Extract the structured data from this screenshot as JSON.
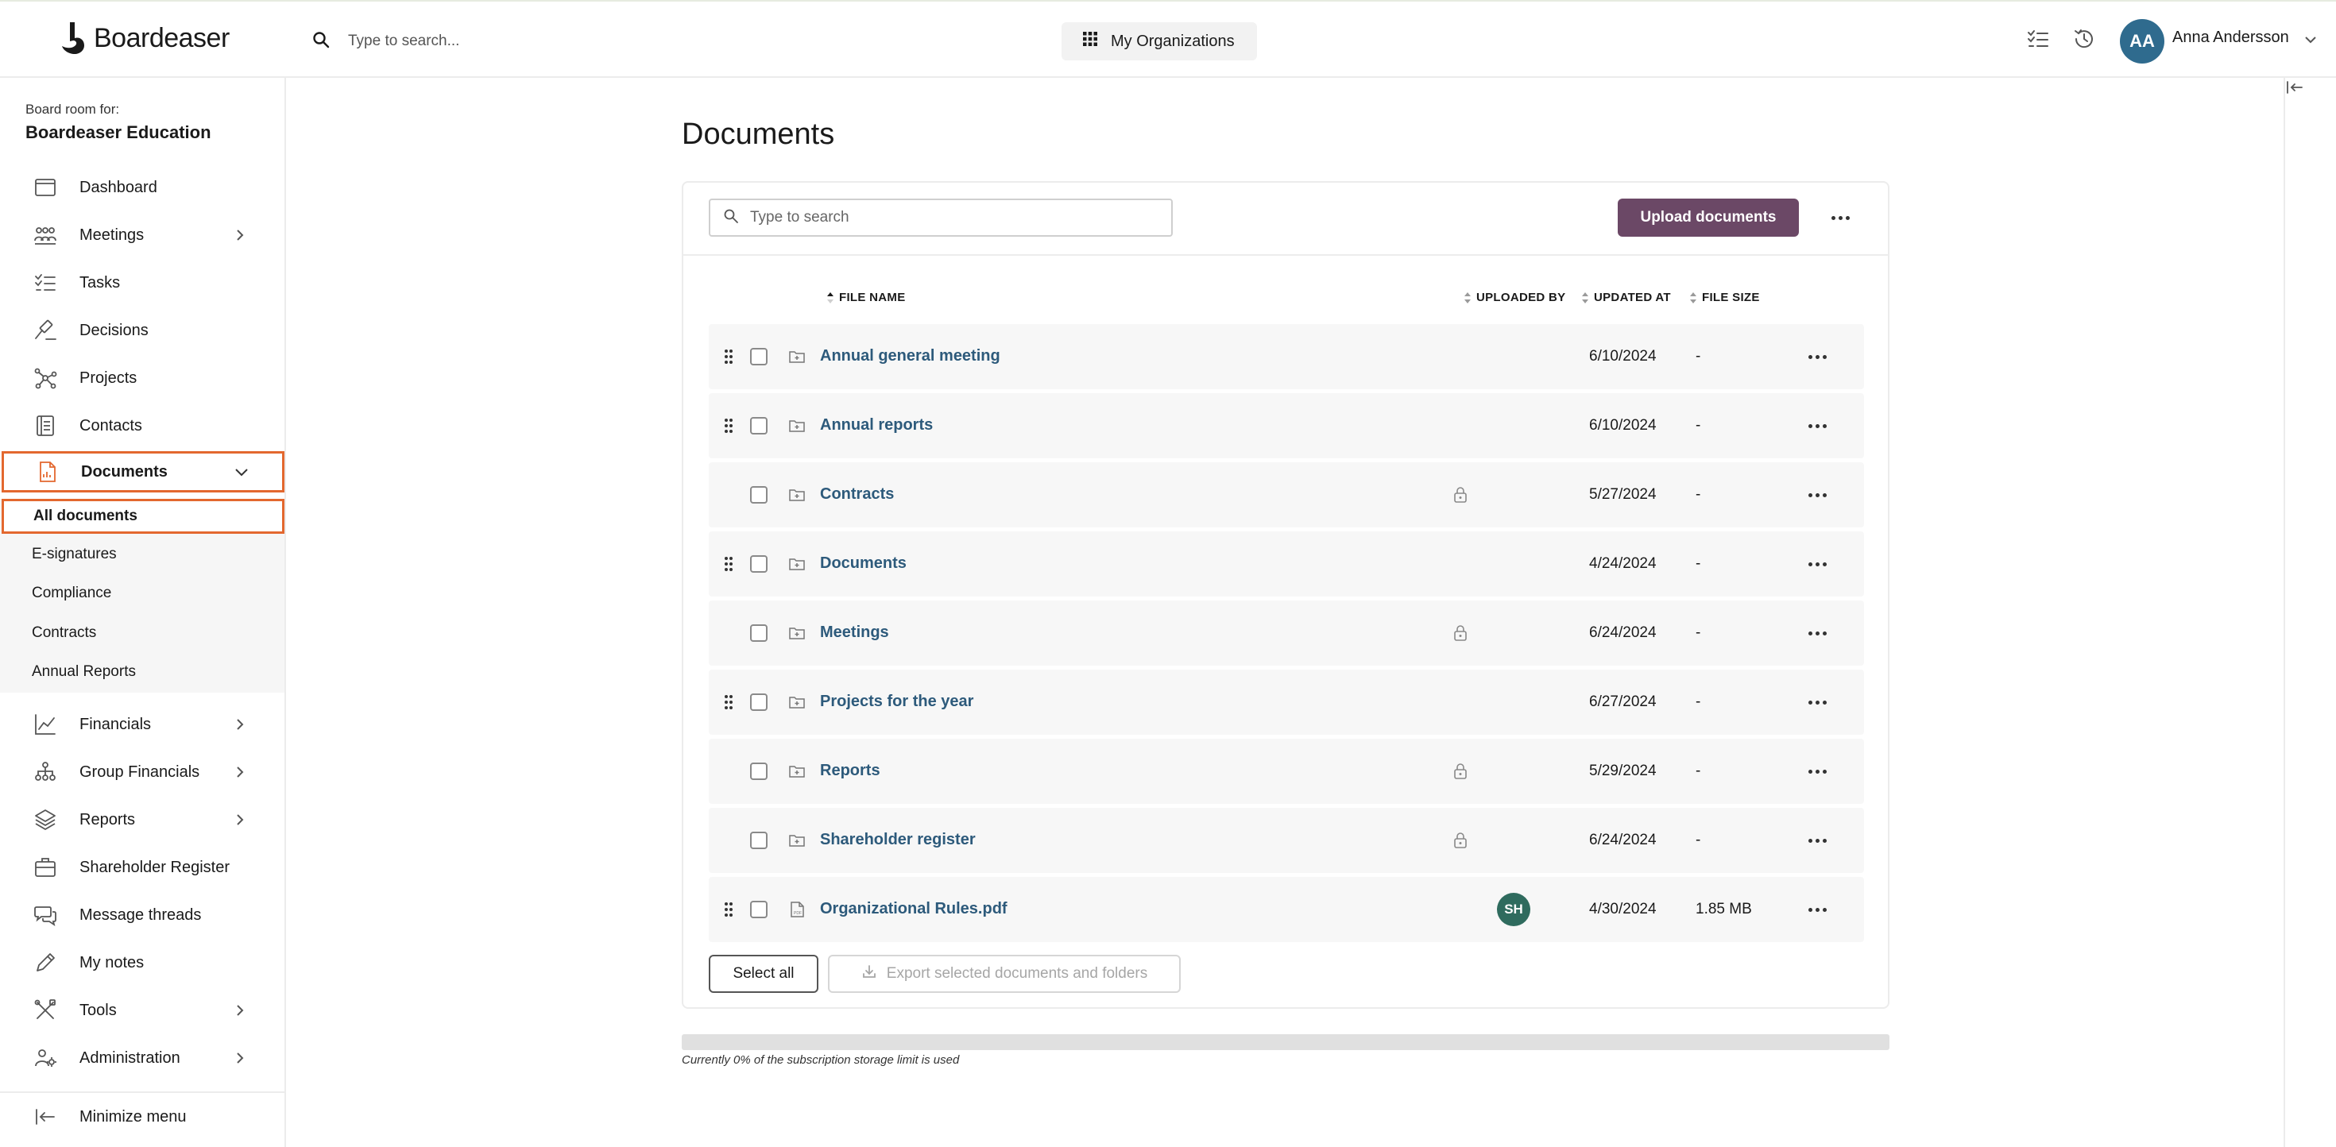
{
  "brand": {
    "name": "Boardeaser"
  },
  "topbar": {
    "search_placeholder": "Type to search...",
    "org_button": "My Organizations",
    "user_initials": "AA",
    "user_name": "Anna Andersson"
  },
  "sidebar": {
    "board_for": "Board room for:",
    "board_name": "Boardeaser Education",
    "items": [
      {
        "label": "Dashboard",
        "icon": "dashboard-icon",
        "chevron": false
      },
      {
        "label": "Meetings",
        "icon": "meetings-icon",
        "chevron": true
      },
      {
        "label": "Tasks",
        "icon": "tasks-icon",
        "chevron": false
      },
      {
        "label": "Decisions",
        "icon": "gavel-icon",
        "chevron": false
      },
      {
        "label": "Projects",
        "icon": "projects-icon",
        "chevron": false
      },
      {
        "label": "Contacts",
        "icon": "contacts-icon",
        "chevron": false
      },
      {
        "label": "Documents",
        "icon": "documents-icon",
        "chevron": true
      }
    ],
    "documents_sub": [
      {
        "label": "All documents"
      },
      {
        "label": "E-signatures"
      },
      {
        "label": "Compliance"
      },
      {
        "label": "Contracts"
      },
      {
        "label": "Annual Reports"
      }
    ],
    "items2": [
      {
        "label": "Financials",
        "icon": "financials-icon",
        "chevron": true
      },
      {
        "label": "Group Financials",
        "icon": "group-financials-icon",
        "chevron": true
      },
      {
        "label": "Reports",
        "icon": "reports-icon",
        "chevron": true
      },
      {
        "label": "Shareholder Register",
        "icon": "briefcase-icon",
        "chevron": false
      },
      {
        "label": "Message threads",
        "icon": "message-icon",
        "chevron": false
      },
      {
        "label": "My notes",
        "icon": "pencil-icon",
        "chevron": false
      },
      {
        "label": "Tools",
        "icon": "tools-icon",
        "chevron": true
      },
      {
        "label": "Administration",
        "icon": "admin-icon",
        "chevron": true
      }
    ],
    "minimize_label": "Minimize menu"
  },
  "main": {
    "title": "Documents",
    "search_placeholder": "Type to search",
    "upload_label": "Upload documents",
    "columns": {
      "file_name": "FILE NAME",
      "uploaded_by": "UPLOADED BY",
      "updated_at": "UPDATED AT",
      "file_size": "FILE SIZE"
    },
    "rows": [
      {
        "name": "Annual general meeting",
        "type": "folder",
        "draggable": true,
        "locked": false,
        "uploaded_by": "",
        "updated": "6/10/2024",
        "size": "-"
      },
      {
        "name": "Annual reports",
        "type": "folder",
        "draggable": true,
        "locked": false,
        "uploaded_by": "",
        "updated": "6/10/2024",
        "size": "-"
      },
      {
        "name": "Contracts",
        "type": "folder",
        "draggable": false,
        "locked": true,
        "uploaded_by": "",
        "updated": "5/27/2024",
        "size": "-"
      },
      {
        "name": "Documents",
        "type": "folder",
        "draggable": true,
        "locked": false,
        "uploaded_by": "",
        "updated": "4/24/2024",
        "size": "-"
      },
      {
        "name": "Meetings",
        "type": "folder",
        "draggable": false,
        "locked": true,
        "uploaded_by": "",
        "updated": "6/24/2024",
        "size": "-"
      },
      {
        "name": "Projects for the year",
        "type": "folder",
        "draggable": true,
        "locked": false,
        "uploaded_by": "",
        "updated": "6/27/2024",
        "size": "-"
      },
      {
        "name": "Reports",
        "type": "folder",
        "draggable": false,
        "locked": true,
        "uploaded_by": "",
        "updated": "5/29/2024",
        "size": "-"
      },
      {
        "name": "Shareholder register",
        "type": "folder",
        "draggable": false,
        "locked": true,
        "uploaded_by": "",
        "updated": "6/24/2024",
        "size": "-"
      },
      {
        "name": "Organizational Rules.pdf",
        "type": "pdf",
        "draggable": true,
        "locked": false,
        "uploaded_by": "SH",
        "updated": "4/30/2024",
        "size": "1.85 MB"
      }
    ],
    "select_all_label": "Select all",
    "export_label": "Export selected documents and folders",
    "storage": {
      "percent_used": 0,
      "text": "Currently 0% of the subscription storage limit is used"
    }
  },
  "colors": {
    "accent": "#6b4866",
    "link": "#2d5a7b",
    "highlight_outline": "#e3682f",
    "avatar": "#2f6b8e"
  }
}
